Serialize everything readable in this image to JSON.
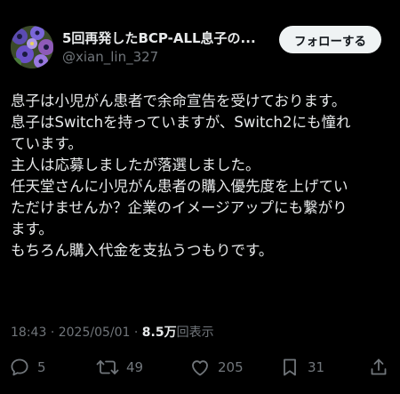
{
  "post": {
    "author": {
      "display_name": "5回再発したBCP-ALL息子の...",
      "handle": "@xian_lin_327"
    },
    "follow_label": "フォローする",
    "text_lines": [
      "息子は小児がん患者で余命宣告を受けております。",
      "息子はSwitchを持っていますが、Switch2にも憧れ",
      "ています。",
      "主人は応募しましたが落選しました。",
      "任天堂さんに小児がん患者の購入優先度を上げてい",
      "ただけませんか？企業のイメージアップにも繋がり",
      "ます。",
      "もちろん購入代金を支払うつもりです。"
    ],
    "time": "18:43",
    "separator": "·",
    "date": "2025/05/01",
    "views_count": "8.5万",
    "views_label": "回表示",
    "actions": {
      "replies": "5",
      "reposts": "49",
      "likes": "205",
      "bookmarks": "31"
    }
  },
  "colors": {
    "background": "#000000",
    "primary_text": "#e7e9ea",
    "secondary_text": "#71767b",
    "button_bg": "#eff3f4",
    "button_text": "#0f1419"
  },
  "icons": {
    "reply": "speech-bubble-icon",
    "repost": "repost-arrows-icon",
    "like": "heart-icon",
    "bookmark": "bookmark-icon",
    "share": "share-upload-icon"
  }
}
